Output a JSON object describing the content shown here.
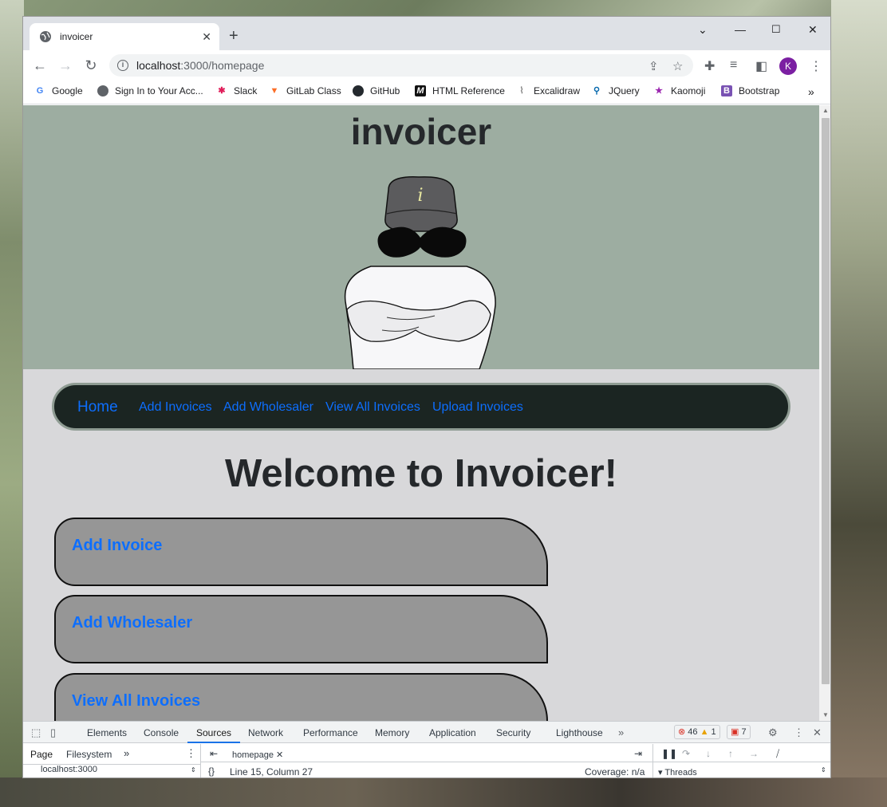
{
  "browser": {
    "tab_title": "invoicer",
    "url_host": "localhost",
    "url_rest": ":3000/homepage",
    "avatar_letter": "K",
    "bookmarks": [
      {
        "label": "Google",
        "icon": "google-icon",
        "color": "#4285f4"
      },
      {
        "label": "Sign In to Your Acc...",
        "icon": "globe-icon",
        "color": "#5f6368"
      },
      {
        "label": "Slack",
        "icon": "slack-icon",
        "color": "#e01e5a"
      },
      {
        "label": "GitLab Class",
        "icon": "gitlab-icon",
        "color": "#fc6d26"
      },
      {
        "label": "GitHub",
        "icon": "github-icon",
        "color": "#24292e"
      },
      {
        "label": "HTML Reference",
        "icon": "m-icon",
        "color": "#111111"
      },
      {
        "label": "Excalidraw",
        "icon": "paperclip-icon",
        "color": "#888888"
      },
      {
        "label": "JQuery",
        "icon": "search-icon",
        "color": "#0769ad"
      },
      {
        "label": "Kaomoji",
        "icon": "star-icon",
        "color": "#9c27b0"
      },
      {
        "label": "Bootstrap",
        "icon": "bootstrap-icon",
        "color": "#7952b3"
      }
    ]
  },
  "page": {
    "site_title": "invoicer",
    "nav": {
      "home": "Home",
      "items": [
        "Add Invoices",
        "Add Wholesaler",
        "View All Invoices",
        "Upload Invoices"
      ]
    },
    "welcome": "Welcome to Invoicer!",
    "cards": [
      "Add Invoice",
      "Add Wholesaler",
      "View All Invoices"
    ],
    "hat_letter": "i"
  },
  "devtools": {
    "tabs": [
      "Elements",
      "Console",
      "Sources",
      "Network",
      "Performance",
      "Memory",
      "Application",
      "Security",
      "Lighthouse"
    ],
    "active_tab": "Sources",
    "errors": "46",
    "warnings": "1",
    "issues": "7",
    "nav_tabs": [
      "Page",
      "Filesystem"
    ],
    "file_tab": "homepage",
    "tree_item": "localhost:3000",
    "cursor_position": "Line 15, Column 27",
    "coverage": "Coverage: n/a",
    "threads": "Threads"
  },
  "colors": {
    "hero_bg": "#9dada1",
    "page_bg": "#d8d8da",
    "nav_bg": "#1b2522",
    "link": "#0d6efd",
    "card_bg": "#969696"
  }
}
